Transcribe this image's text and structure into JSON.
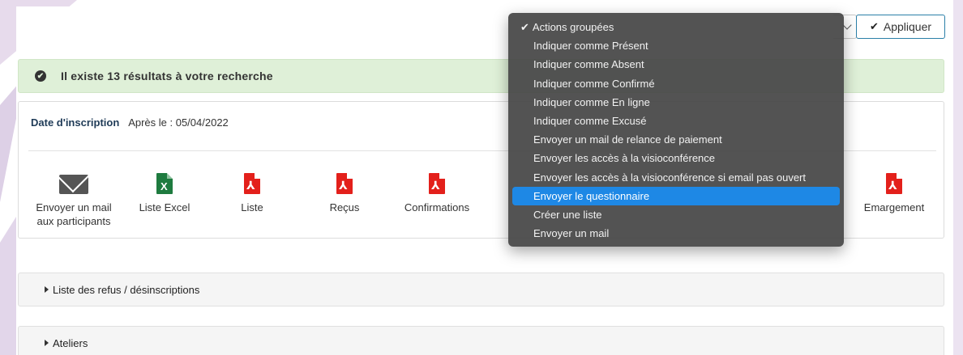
{
  "toolbar": {
    "apply_label": "Appliquer",
    "apply_icon": "check-icon"
  },
  "banner": {
    "icon": "check-circle-icon",
    "text": "Il existe 13 résultats à votre recherche",
    "color": "#dff0d8"
  },
  "filter": {
    "label": "Date d'inscription",
    "value": "Après le : 05/04/2022"
  },
  "exports": [
    {
      "label": "Envoyer un mail aux participants",
      "icon": "mail-icon"
    },
    {
      "label": "Liste Excel",
      "icon": "excel-icon"
    },
    {
      "label": "Liste",
      "icon": "pdf-icon"
    },
    {
      "label": "Reçus",
      "icon": "pdf-icon"
    },
    {
      "label": "Confirmations",
      "icon": "pdf-icon"
    },
    {
      "label": "Emargement",
      "icon": "pdf-icon"
    }
  ],
  "sections": [
    {
      "label": "Liste des refus / désinscriptions"
    },
    {
      "label": "Ateliers"
    }
  ],
  "dropdown": {
    "selected_mark": "✔",
    "accent": "#1e88e5",
    "items": [
      "Actions groupées",
      "Indiquer comme Présent",
      "Indiquer comme Absent",
      "Indiquer comme Confirmé",
      "Indiquer comme En ligne",
      "Indiquer comme Excusé",
      "Envoyer un mail de relance de paiement",
      "Envoyer les accès à la visioconférence",
      "Envoyer les accès à la visioconférence si email pas ouvert",
      "Envoyer le questionnaire",
      "Créer une liste",
      "Envoyer un mail"
    ],
    "highlighted": "Envoyer le questionnaire"
  }
}
